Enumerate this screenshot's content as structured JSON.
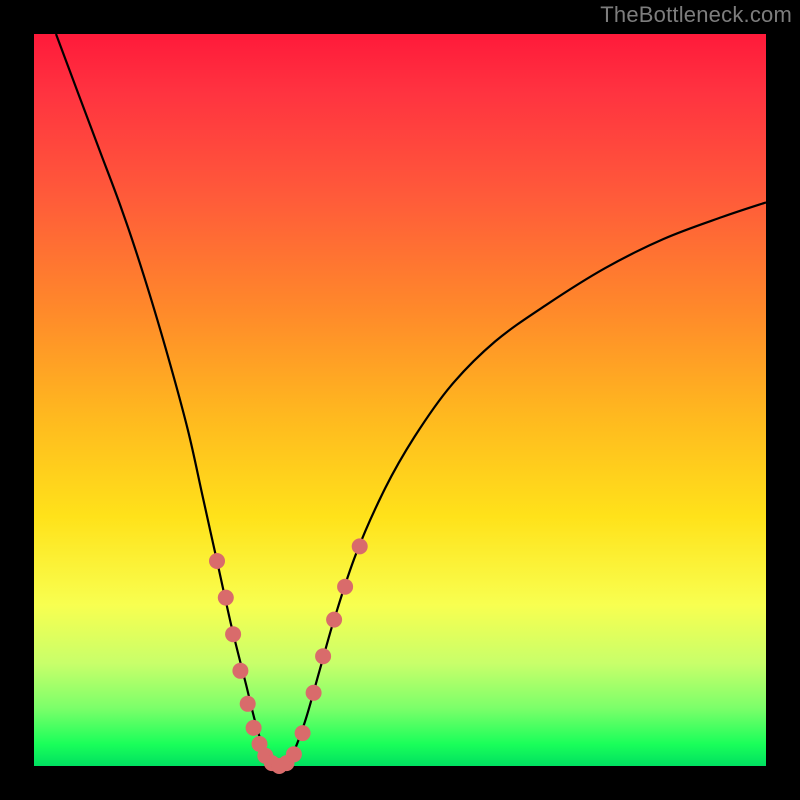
{
  "watermark": "TheBottleneck.com",
  "chart_data": {
    "type": "line",
    "title": "",
    "xlabel": "",
    "ylabel": "",
    "xlim": [
      0,
      100
    ],
    "ylim": [
      0,
      100
    ],
    "curve": {
      "name": "bottleneck-curve",
      "description": "V-shaped bottleneck percentage curve (estimated, unlabeled axes)",
      "points": [
        {
          "x": 3,
          "y": 100
        },
        {
          "x": 6,
          "y": 92
        },
        {
          "x": 9,
          "y": 84
        },
        {
          "x": 12,
          "y": 76
        },
        {
          "x": 15,
          "y": 67
        },
        {
          "x": 18,
          "y": 57
        },
        {
          "x": 21,
          "y": 46
        },
        {
          "x": 23,
          "y": 37
        },
        {
          "x": 25,
          "y": 28
        },
        {
          "x": 27,
          "y": 19
        },
        {
          "x": 29,
          "y": 11
        },
        {
          "x": 30.5,
          "y": 5
        },
        {
          "x": 32,
          "y": 1
        },
        {
          "x": 33.5,
          "y": 0
        },
        {
          "x": 35,
          "y": 1
        },
        {
          "x": 37,
          "y": 6
        },
        {
          "x": 39,
          "y": 13
        },
        {
          "x": 41,
          "y": 20
        },
        {
          "x": 44,
          "y": 29
        },
        {
          "x": 48,
          "y": 38
        },
        {
          "x": 52,
          "y": 45
        },
        {
          "x": 57,
          "y": 52
        },
        {
          "x": 63,
          "y": 58
        },
        {
          "x": 70,
          "y": 63
        },
        {
          "x": 78,
          "y": 68
        },
        {
          "x": 86,
          "y": 72
        },
        {
          "x": 94,
          "y": 75
        },
        {
          "x": 100,
          "y": 77
        }
      ]
    },
    "markers": {
      "name": "highlight-points",
      "color": "#d96b6b",
      "radius": 8,
      "points": [
        {
          "x": 25.0,
          "y": 28
        },
        {
          "x": 26.2,
          "y": 23
        },
        {
          "x": 27.2,
          "y": 18
        },
        {
          "x": 28.2,
          "y": 13
        },
        {
          "x": 29.2,
          "y": 8.5
        },
        {
          "x": 30.0,
          "y": 5.2
        },
        {
          "x": 30.8,
          "y": 3.0
        },
        {
          "x": 31.6,
          "y": 1.4
        },
        {
          "x": 32.5,
          "y": 0.4
        },
        {
          "x": 33.5,
          "y": 0.0
        },
        {
          "x": 34.5,
          "y": 0.4
        },
        {
          "x": 35.5,
          "y": 1.6
        },
        {
          "x": 36.7,
          "y": 4.5
        },
        {
          "x": 38.2,
          "y": 10
        },
        {
          "x": 39.5,
          "y": 15
        },
        {
          "x": 41.0,
          "y": 20
        },
        {
          "x": 42.5,
          "y": 24.5
        },
        {
          "x": 44.5,
          "y": 30
        }
      ]
    }
  }
}
